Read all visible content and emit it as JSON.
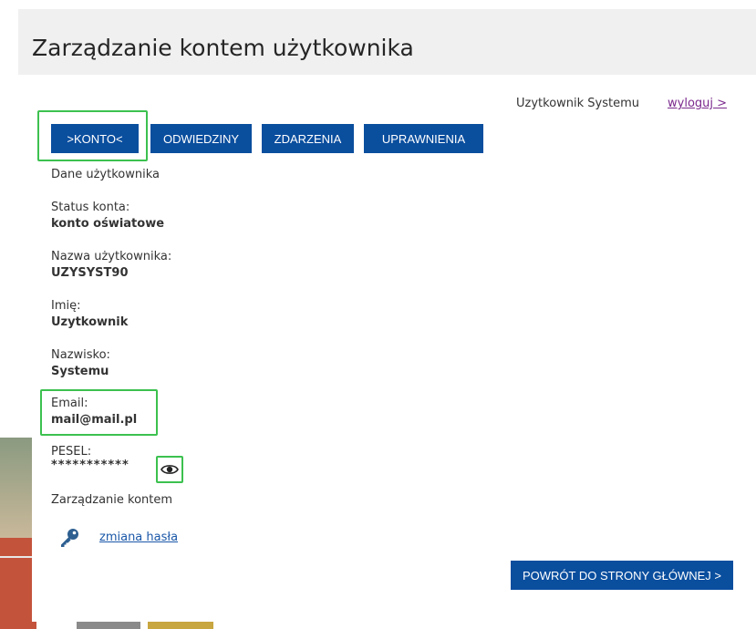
{
  "page": {
    "title": "Zarządzanie kontem użytkownika"
  },
  "header": {
    "user_name": "Uzytkownik Systemu",
    "logout_label": "wyloguj >"
  },
  "tabs": [
    {
      "label": ">KONTO<",
      "active": true
    },
    {
      "label": "ODWIEDZINY",
      "active": false
    },
    {
      "label": "ZDARZENIA",
      "active": false
    },
    {
      "label": "UPRAWNIENIA",
      "active": false
    }
  ],
  "account": {
    "section_title": "Dane użytkownika",
    "status_label": "Status konta:",
    "status_value": "konto oświatowe",
    "username_label": "Nazwa użytkownika:",
    "username_value": "UZYSYST90",
    "first_name_label": "Imię:",
    "first_name_value": "Uzytkownik",
    "last_name_label": "Nazwisko:",
    "last_name_value": "Systemu",
    "email_label": "Email:",
    "email_value": "mail@mail.pl",
    "pesel_label": "PESEL:",
    "pesel_value": "***********"
  },
  "management": {
    "title": "Zarządzanie kontem",
    "change_password_label": "zmiana hasła"
  },
  "footer": {
    "home_button_label": "POWRÓT DO STRONY GŁÓWNEJ >"
  },
  "icons": {
    "password": "key-icon",
    "reveal": "eye-icon"
  },
  "colors": {
    "accent": "#0a4e9e",
    "highlight": "#3cc14f",
    "link": "#1a57a8",
    "visited_link": "#7b2a8d"
  }
}
